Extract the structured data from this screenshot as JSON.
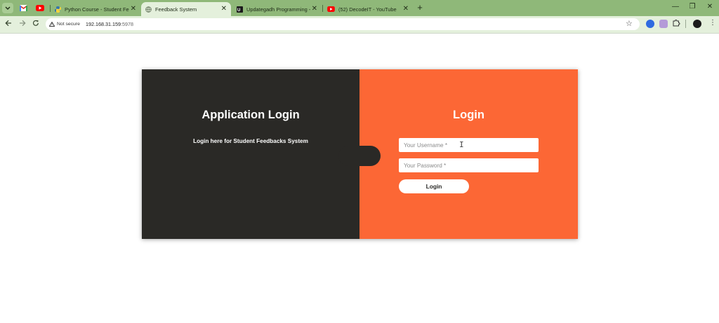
{
  "browser": {
    "tabs": [
      {
        "title": "Python Course - Student Feedb",
        "active": false
      },
      {
        "title": "Feedback System",
        "active": true
      },
      {
        "title": "Updategadh Programming - U",
        "active": false
      },
      {
        "title": "(52) DecodeIT - YouTube",
        "active": false
      }
    ],
    "security_label": "Not secure",
    "url_host": "192.168.31.159",
    "url_port": ":5978"
  },
  "page": {
    "left_title": "Application Login",
    "left_subtitle": "Login here for Student Feedbacks System",
    "right_title": "Login",
    "username_placeholder": "Your Username *",
    "password_placeholder": "Your Password *",
    "login_button": "Login"
  },
  "colors": {
    "dark_panel": "#2a2926",
    "accent_panel": "#fc6735",
    "browser_frame": "#8fb879"
  }
}
